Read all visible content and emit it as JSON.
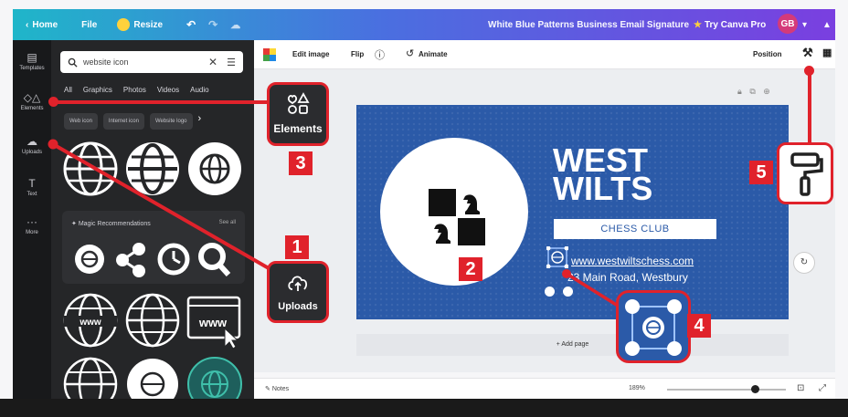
{
  "topbar": {
    "home": "Home",
    "file": "File",
    "resize": "Resize",
    "doc_title": "White Blue Patterns Business Email Signature",
    "try_pro": "Try Canva Pro",
    "avatar_initials": "GB"
  },
  "rail": {
    "items": [
      {
        "label": "Templates",
        "icon": "template-icon"
      },
      {
        "label": "Elements",
        "icon": "elements-icon"
      },
      {
        "label": "Uploads",
        "icon": "uploads-icon"
      },
      {
        "label": "Text",
        "icon": "text-icon"
      },
      {
        "label": "More",
        "icon": "more-icon"
      }
    ]
  },
  "panel": {
    "search_value": "website icon",
    "tabs": [
      "All",
      "Graphics",
      "Photos",
      "Videos",
      "Audio"
    ],
    "chips": [
      "Web icon",
      "Internet icon",
      "Website logo"
    ],
    "magic_title": "Magic Recommendations",
    "see_all": "See all"
  },
  "toolbar": {
    "edit_image": "Edit image",
    "flip": "Flip",
    "animate": "Animate",
    "position": "Position"
  },
  "card": {
    "title_line1": "WEST",
    "title_line2": "WILTS",
    "subtitle": "CHESS CLUB",
    "url": "www.westwiltschess.com",
    "address": "23 Main Road, Westbury"
  },
  "add_page": "+ Add page",
  "bottom": {
    "notes": "Notes",
    "zoom": "189%",
    "zoom_fraction": 0.74
  },
  "callouts": {
    "elements_label": "Elements",
    "uploads_label": "Uploads",
    "tags": [
      "1",
      "2",
      "3",
      "4",
      "5"
    ]
  },
  "colors": {
    "accent_red": "#e0222b",
    "card_blue": "#2b5aa8",
    "panel_dark": "#252628"
  }
}
